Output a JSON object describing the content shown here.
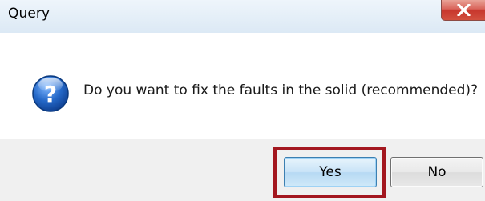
{
  "window": {
    "title": "Query",
    "close_icon": "close-icon"
  },
  "message": {
    "icon": "question-icon",
    "text": "Do you want to fix the faults in the solid (recommended)?"
  },
  "buttons": {
    "yes_label": "Yes",
    "no_label": "No",
    "highlight_color": "#a3171f"
  },
  "colors": {
    "titlebar": "#dce9f5",
    "footer": "#f0f0f0",
    "close_button": "#c7362c",
    "icon_blue": "#1f5fb3"
  }
}
